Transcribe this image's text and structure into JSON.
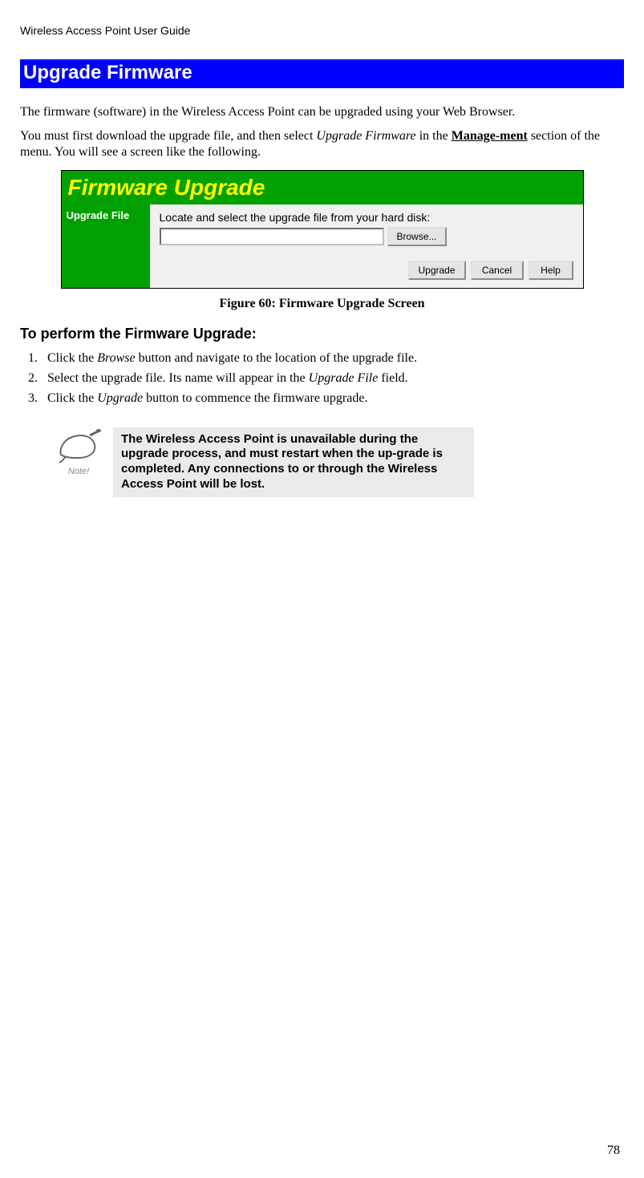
{
  "headerTitle": "Wireless Access Point User Guide",
  "sectionTitle": "Upgrade Firmware",
  "para1": "The firmware (software) in the Wireless Access Point can be upgraded using your Web Browser.",
  "para2a": "You must first download the upgrade file, and then select ",
  "para2Italic": "Upgrade Firmware",
  "para2b": " in the ",
  "para2Bold": "Manage-ment",
  "para2c": " section of the menu. You will see a screen like the following.",
  "figure": {
    "title": "Firmware Upgrade",
    "sidebarLabel": "Upgrade File",
    "hint": "Locate and select the upgrade file from your hard disk:",
    "inputValue": "",
    "browseLabel": "Browse...",
    "upgradeLabel": "Upgrade",
    "cancelLabel": "Cancel",
    "helpLabel": "Help"
  },
  "caption": "Figure 60: Firmware Upgrade Screen",
  "subheader": "To perform the Firmware Upgrade:",
  "steps": {
    "s1a": "Click the ",
    "s1i": "Browse",
    "s1b": " button and navigate to the location of the upgrade file.",
    "s2a": "Select the upgrade file. Its name will appear in the ",
    "s2i": "Upgrade File",
    "s2b": " field.",
    "s3a": "Click the ",
    "s3i": "Upgrade",
    "s3b": " button to commence the firmware upgrade."
  },
  "noteLabel": "Note!",
  "noteText": "The Wireless Access Point is unavailable during the upgrade process, and must restart when the up-grade is completed. Any connections to or through the Wireless Access Point will be lost.",
  "pageNumber": "78"
}
